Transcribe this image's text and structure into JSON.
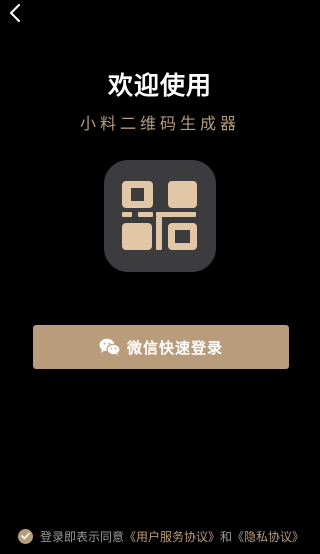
{
  "header": {
    "back_icon": "chevron-left-icon"
  },
  "welcome": {
    "title": "欢迎使用",
    "subtitle": "小料二维码生成器"
  },
  "logo": {
    "icon": "qr-code-app-icon",
    "background_color": "#3c3c3e",
    "glyph_color": "#e2c7a7"
  },
  "login_button": {
    "icon": "wechat-icon",
    "label": "微信快速登录",
    "color": "#b89c7b"
  },
  "agreement": {
    "checked": true,
    "prefix": "登录即表示同意",
    "user_agreement_link": "《用户服务协议》",
    "conjunction": "和",
    "privacy_link": "《隐私协议》"
  },
  "colors": {
    "background": "#000000",
    "accent": "#b89c7b",
    "muted_text": "#9a9a9a"
  }
}
